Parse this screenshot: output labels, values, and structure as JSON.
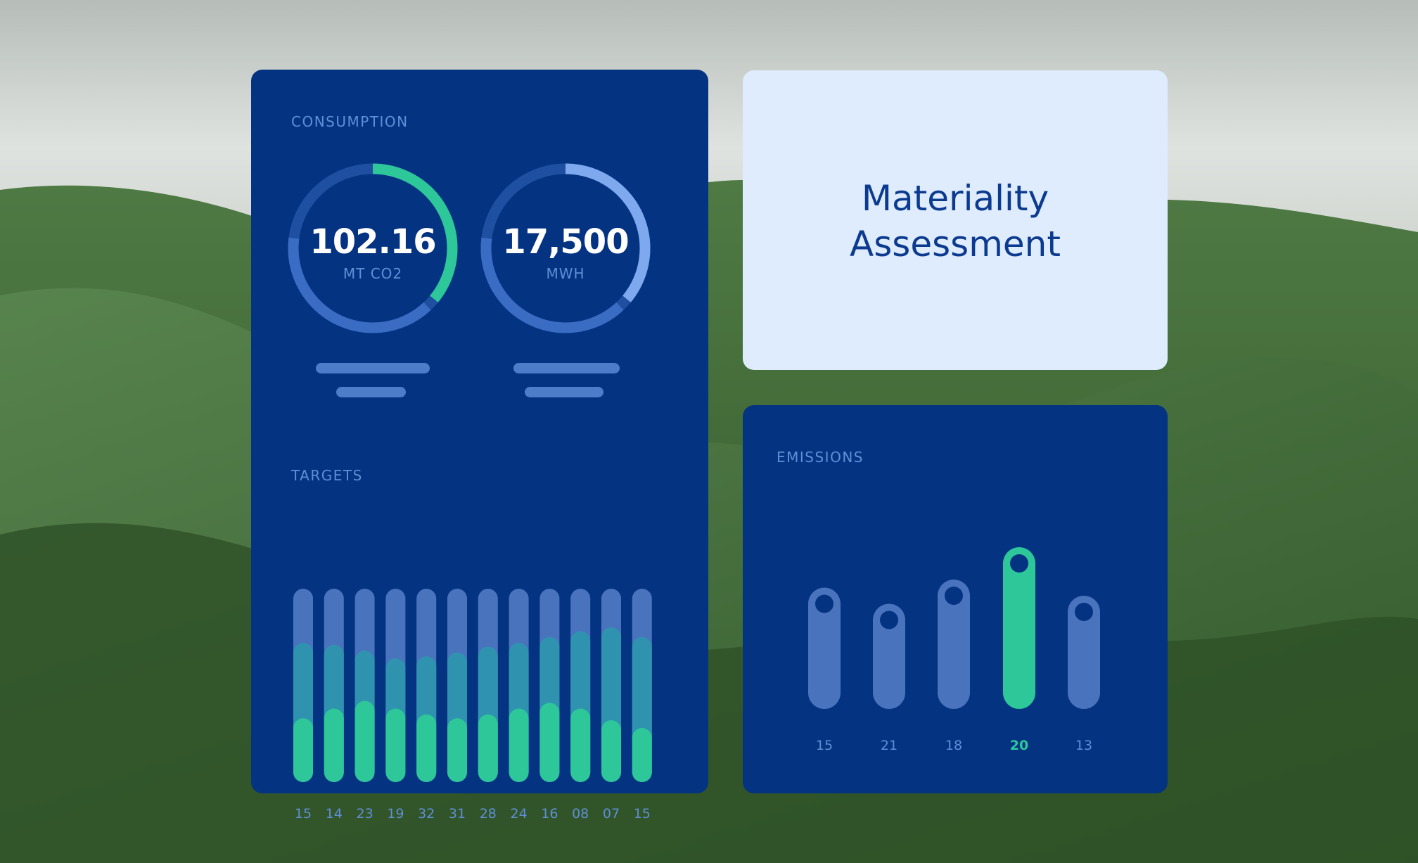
{
  "colors": {
    "card_dark": "#043382",
    "card_light": "#deecfd",
    "bar_track": "#4a73bd",
    "bar_mid": "#2f93b0",
    "accent_green": "#2dc79a",
    "label_blue": "#5f8fd5",
    "title_blue": "#0c3a8f"
  },
  "consumption": {
    "label": "CONSUMPTION",
    "gauges": [
      {
        "value": "102.16",
        "unit": "MT CO2",
        "fraction": 0.36,
        "accent": "#2dc79a"
      },
      {
        "value": "17,500",
        "unit": "MWH",
        "fraction": 0.36,
        "accent": "#7ea9ee"
      }
    ]
  },
  "targets": {
    "label": "TARGETS",
    "chart_data": {
      "type": "bar",
      "categories": [
        "15",
        "14",
        "23",
        "19",
        "32",
        "31",
        "28",
        "24",
        "16",
        "08",
        "07",
        "15"
      ],
      "series": [
        {
          "values": [
            0.72,
            0.71,
            0.68,
            0.64,
            0.65,
            0.67,
            0.7,
            0.72,
            0.75,
            0.78,
            0.8,
            0.75
          ]
        },
        {
          "values": [
            0.33,
            0.38,
            0.42,
            0.38,
            0.35,
            0.33,
            0.35,
            0.38,
            0.41,
            0.38,
            0.32,
            0.28
          ]
        }
      ],
      "ylim": [
        0,
        1
      ]
    }
  },
  "materiality": {
    "title_line1": "Materiality",
    "title_line2": "Assessment"
  },
  "emissions": {
    "label": "EMISSIONS",
    "chart_data": {
      "type": "bar",
      "categories": [
        "15",
        "21",
        "18",
        "20",
        "13"
      ],
      "values": [
        15,
        13,
        16,
        20,
        14
      ],
      "highlight": "20",
      "ylim": [
        0,
        20
      ]
    }
  }
}
